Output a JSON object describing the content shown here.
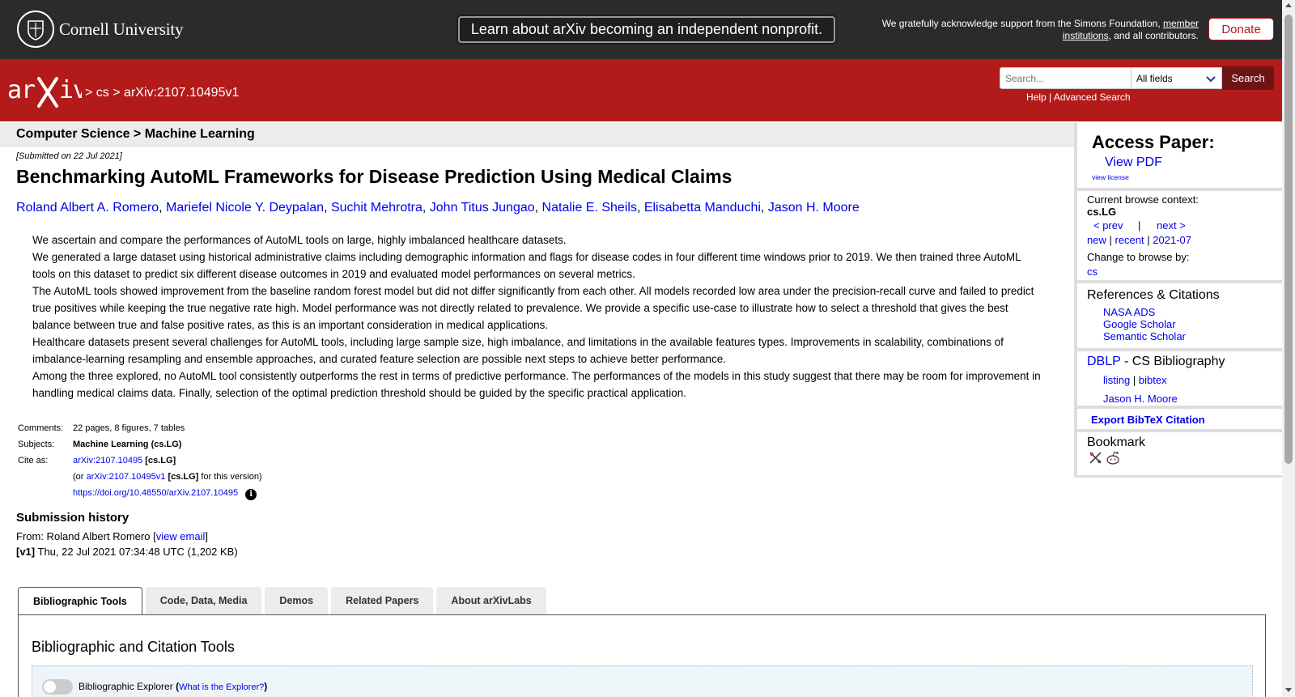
{
  "top_bar": {
    "university": "Cornell University",
    "nonprofit_banner": "Learn about arXiv becoming an independent nonprofit.",
    "support_prefix": "We gratefully acknowledge support from the Simons Foundation, ",
    "support_link": "member institutions",
    "support_suffix": ", and all contributors.",
    "donate_label": "Donate"
  },
  "header": {
    "logo_text": "arXiv",
    "breadcrumb_sep1": ">",
    "breadcrumb_cs": "cs",
    "breadcrumb_sep2": ">",
    "breadcrumb_id": "arXiv:2107.10495v1",
    "search_placeholder": "Search...",
    "search_field_selected": "All fields",
    "search_button": "Search",
    "help_link": "Help",
    "help_sep": "|",
    "advanced_search_link": "Advanced Search"
  },
  "paper": {
    "subject_header": "Computer Science > Machine Learning",
    "submitted": "[Submitted on 22 Jul 2021]",
    "title": "Benchmarking AutoML Frameworks for Disease Prediction Using Medical Claims",
    "authors": [
      "Roland Albert A. Romero",
      "Mariefel Nicole Y. Deypalan",
      "Suchit Mehrotra",
      "John Titus Jungao",
      "Natalie E. Sheils",
      "Elisabetta Manduchi",
      "Jason H. Moore"
    ],
    "abstract": [
      "We ascertain and compare the performances of AutoML tools on large, highly imbalanced healthcare datasets.",
      "We generated a large dataset using historical administrative claims including demographic information and flags for disease codes in four different time windows prior to 2019. We then trained three AutoML tools on this dataset to predict six different disease outcomes in 2019 and evaluated model performances on several metrics.",
      "The AutoML tools showed improvement from the baseline random forest model but did not differ significantly from each other. All models recorded low area under the precision-recall curve and failed to predict true positives while keeping the true negative rate high. Model performance was not directly related to prevalence. We provide a specific use-case to illustrate how to select a threshold that gives the best balance between true and false positive rates, as this is an important consideration in medical applications.",
      "Healthcare datasets present several challenges for AutoML tools, including large sample size, high imbalance, and limitations in the available features types. Improvements in scalability, combinations of imbalance-learning resampling and ensemble approaches, and curated feature selection are possible next steps to achieve better performance.",
      "Among the three explored, no AutoML tool consistently outperforms the rest in terms of predictive performance. The performances of the models in this study suggest that there may be room for improvement in handling medical claims data. Finally, selection of the optimal prediction threshold should be guided by the specific practical application."
    ],
    "meta": {
      "comments_label": "Comments:",
      "comments": "22 pages, 8 figures, 7 tables",
      "subjects_label": "Subjects:",
      "subjects": "Machine Learning (cs.LG)",
      "cite_label": "Cite as:",
      "cite_id": "arXiv:2107.10495",
      "cite_tag": "[cs.LG]",
      "cite_or": "(or",
      "cite_version_id": "arXiv:2107.10495v1",
      "cite_version_tag": "[cs.LG]",
      "cite_version_suffix": "for this version)",
      "doi": "https://doi.org/10.48550/arXiv.2107.10495",
      "info_icon": "i"
    },
    "history": {
      "heading": "Submission history",
      "from_label": "From: Roland Albert Romero [",
      "view_email": "view email",
      "from_close": "]",
      "v1_label": "[v1]",
      "v1_text": "Thu, 22 Jul 2021 07:34:48 UTC (1,202 KB)"
    }
  },
  "tabs": {
    "items": [
      "Bibliographic Tools",
      "Code, Data, Media",
      "Demos",
      "Related Papers",
      "About arXivLabs"
    ],
    "panel_heading": "Bibliographic and Citation Tools",
    "explorer_label": "Bibliographic Explorer",
    "explorer_open": "(",
    "explorer_link": "What is the Explorer?",
    "explorer_close": ")"
  },
  "sidebar": {
    "access_heading": "Access Paper:",
    "view_pdf": "View PDF",
    "view_license": "view license",
    "browse_context_label": "Current browse context:",
    "browse_context": "cs.LG",
    "prev": "< prev",
    "nav_sep": "|",
    "next": "next >",
    "new": "new",
    "recent": "recent",
    "month": "2021-07",
    "change_browse": "Change to browse by:",
    "browse_cs": "cs",
    "refs_heading": "References & Citations",
    "nasa_ads": "NASA ADS",
    "google_scholar": "Google Scholar",
    "semantic_scholar": "Semantic Scholar",
    "dblp_link": "DBLP",
    "dblp_suffix": " - CS Bibliography",
    "listing": "listing",
    "bibtex": "bibtex",
    "dblp_author": "Jason H. Moore",
    "export_bibtex": "Export BibTeX Citation",
    "bookmark_heading": "Bookmark"
  },
  "colors": {
    "arxiv_red": "#b31b1b",
    "cornell_bar": "#2b2b2b",
    "link": "#0000ee"
  }
}
